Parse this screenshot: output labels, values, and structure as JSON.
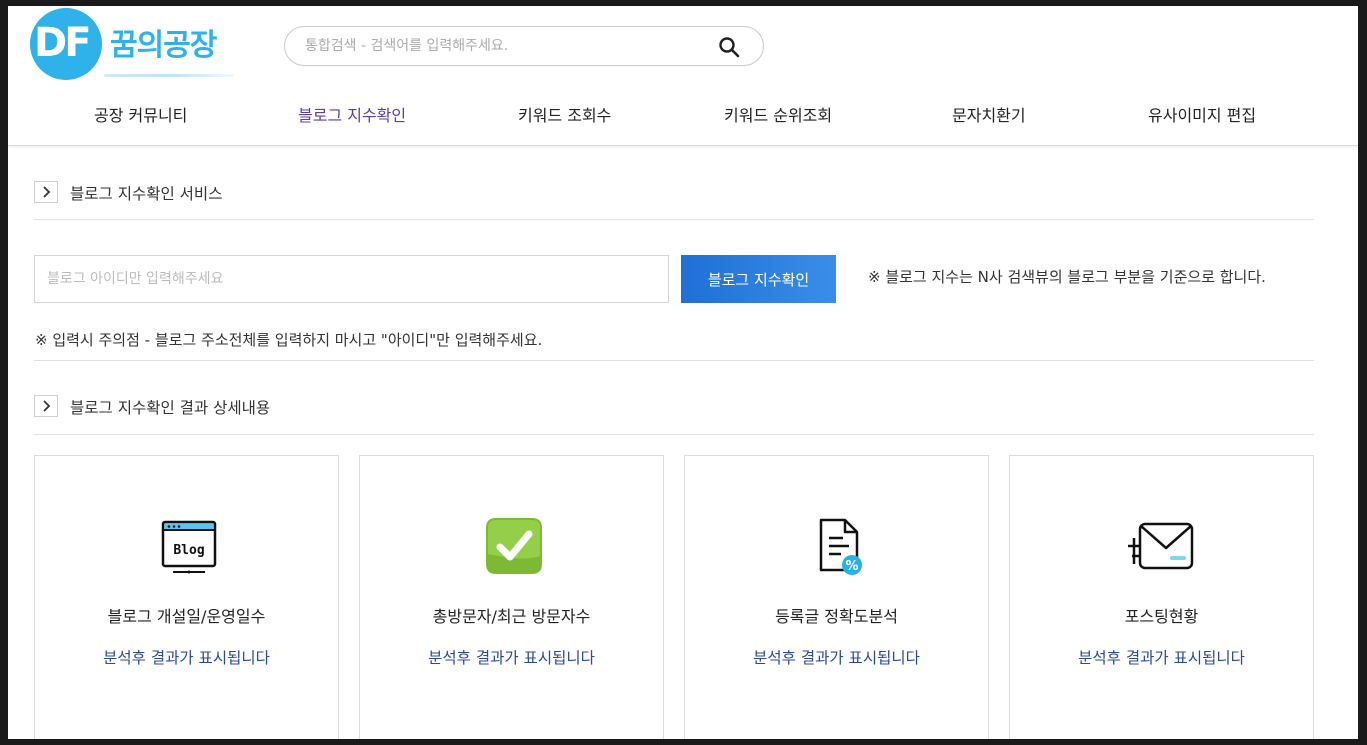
{
  "header": {
    "logo_mark": "DF",
    "logo_name": "꿈의공장",
    "search_placeholder": "통합검색 - 검색어를 입력해주세요."
  },
  "nav": [
    {
      "label": "공장 커뮤니티",
      "active": false
    },
    {
      "label": "블로그 지수확인",
      "active": true
    },
    {
      "label": "키워드 조회수",
      "active": false
    },
    {
      "label": "키워드 순위조회",
      "active": false
    },
    {
      "label": "문자치환기",
      "active": false
    },
    {
      "label": "유사이미지 편집",
      "active": false
    }
  ],
  "service": {
    "title": "블로그 지수확인 서비스",
    "input_placeholder": "블로그 아이디만 입력해주세요",
    "button_label": "블로그 지수확인",
    "note_right": "※ 블로그 지수는 N사 검색뷰의 블로그 부분을 기준으로 합니다.",
    "note_input": "※ 입력시 주의점 - 블로그 주소전체를 입력하지 마시고 \"아이디\"만 입력해주세요."
  },
  "results": {
    "title": "블로그 지수확인 결과 상세내용",
    "cards": [
      {
        "icon": "blog-icon",
        "icon_text": "Blog",
        "title": "블로그 개설일/운영일수",
        "status": "분석후 결과가 표시됩니다"
      },
      {
        "icon": "check-icon",
        "title": "총방문자/최근 방문자수",
        "status": "분석후 결과가 표시됩니다"
      },
      {
        "icon": "document-percent-icon",
        "icon_text": "%",
        "title": "등록글 정확도분석",
        "status": "분석후 결과가 표시됩니다"
      },
      {
        "icon": "envelope-icon",
        "title": "포스팅현황",
        "status": "분석후 결과가 표시됩니다"
      }
    ]
  },
  "colors": {
    "brand": "#2fb2ea",
    "nav_active": "#5a3ea8",
    "button": "#2a7fe0",
    "status_text": "#2a4a9c",
    "check_green": "#8cc63f"
  }
}
